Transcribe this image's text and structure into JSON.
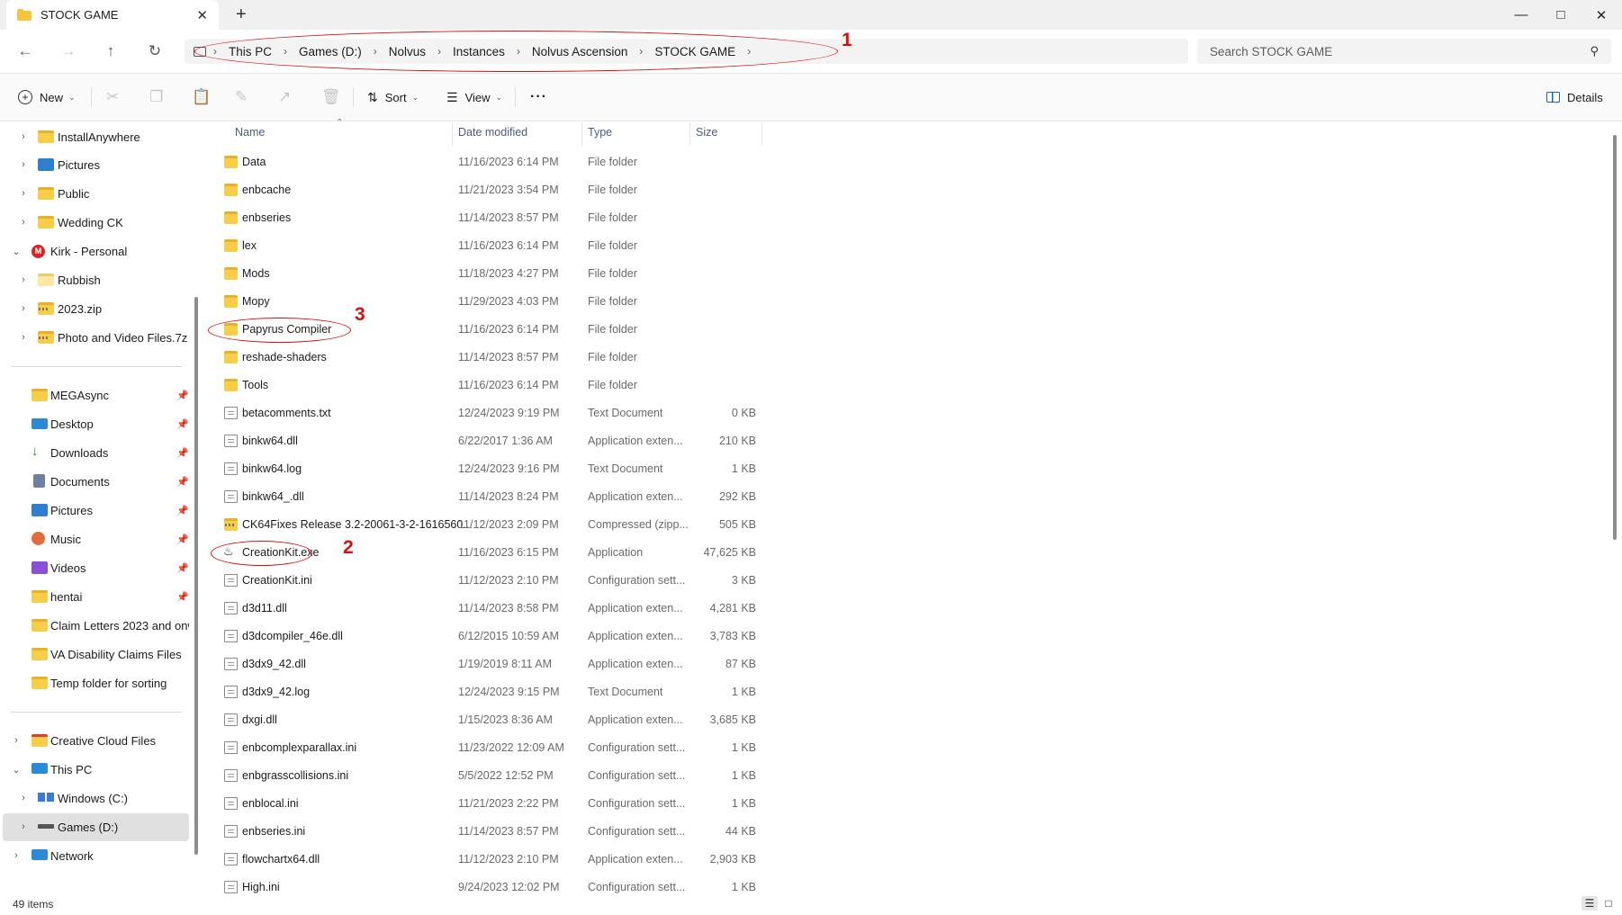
{
  "window": {
    "tab_title": "STOCK GAME",
    "new_tab_glyph": "+",
    "minimize_glyph": "—",
    "maximize_glyph": "□",
    "close_glyph": "✕"
  },
  "address": {
    "breadcrumbs": [
      "This PC",
      "Games (D:)",
      "Nolvus",
      "Instances",
      "Nolvus Ascension",
      "STOCK GAME"
    ],
    "search_placeholder": "Search STOCK GAME"
  },
  "annotations": {
    "one": "1",
    "two": "2",
    "three": "3",
    "color": "#d90f0f"
  },
  "toolbar": {
    "new_label": "New",
    "sort_label": "Sort",
    "view_label": "View",
    "more_glyph": "···",
    "details_label": "Details"
  },
  "sidebar": {
    "items": [
      {
        "label": "InstallAnywhere"
      },
      {
        "label": "Pictures"
      },
      {
        "label": "Public"
      },
      {
        "label": "Wedding CK"
      },
      {
        "label": "Kirk - Personal"
      },
      {
        "label": "Rubbish"
      },
      {
        "label": "2023.zip"
      },
      {
        "label": "Photo and Video Files.7z"
      },
      {
        "label": "MEGAsync"
      },
      {
        "label": "Desktop"
      },
      {
        "label": "Downloads"
      },
      {
        "label": "Documents"
      },
      {
        "label": "Pictures"
      },
      {
        "label": "Music"
      },
      {
        "label": "Videos"
      },
      {
        "label": "hentai"
      },
      {
        "label": "Claim Letters 2023 and onwar"
      },
      {
        "label": "VA Disability Claims Files"
      },
      {
        "label": "Temp folder for sorting"
      },
      {
        "label": "Creative Cloud Files"
      },
      {
        "label": "This PC"
      },
      {
        "label": "Windows (C:)"
      },
      {
        "label": "Games (D:)"
      },
      {
        "label": "Network"
      }
    ]
  },
  "columns": {
    "name": "Name",
    "date": "Date modified",
    "type": "Type",
    "size": "Size"
  },
  "files": [
    {
      "name": "Data",
      "date": "11/16/2023 6:14 PM",
      "type": "File folder",
      "size": ""
    },
    {
      "name": "enbcache",
      "date": "11/21/2023 3:54 PM",
      "type": "File folder",
      "size": ""
    },
    {
      "name": "enbseries",
      "date": "11/14/2023 8:57 PM",
      "type": "File folder",
      "size": ""
    },
    {
      "name": "lex",
      "date": "11/16/2023 6:14 PM",
      "type": "File folder",
      "size": ""
    },
    {
      "name": "Mods",
      "date": "11/18/2023 4:27 PM",
      "type": "File folder",
      "size": ""
    },
    {
      "name": "Mopy",
      "date": "11/29/2023 4:03 PM",
      "type": "File folder",
      "size": ""
    },
    {
      "name": "Papyrus Compiler",
      "date": "11/16/2023 6:14 PM",
      "type": "File folder",
      "size": ""
    },
    {
      "name": "reshade-shaders",
      "date": "11/14/2023 8:57 PM",
      "type": "File folder",
      "size": ""
    },
    {
      "name": "Tools",
      "date": "11/16/2023 6:14 PM",
      "type": "File folder",
      "size": ""
    },
    {
      "name": "betacomments.txt",
      "date": "12/24/2023 9:19 PM",
      "type": "Text Document",
      "size": "0 KB"
    },
    {
      "name": "binkw64.dll",
      "date": "6/22/2017 1:36 AM",
      "type": "Application exten...",
      "size": "210 KB"
    },
    {
      "name": "binkw64.log",
      "date": "12/24/2023 9:16 PM",
      "type": "Text Document",
      "size": "1 KB"
    },
    {
      "name": "binkw64_.dll",
      "date": "11/14/2023 8:24 PM",
      "type": "Application exten...",
      "size": "292 KB"
    },
    {
      "name": "CK64Fixes Release 3.2-20061-3-2-1616560...",
      "date": "11/12/2023 2:09 PM",
      "type": "Compressed (zipp...",
      "size": "505 KB"
    },
    {
      "name": "CreationKit.exe",
      "date": "11/16/2023 6:15 PM",
      "type": "Application",
      "size": "47,625 KB"
    },
    {
      "name": "CreationKit.ini",
      "date": "11/12/2023 2:10 PM",
      "type": "Configuration sett...",
      "size": "3 KB"
    },
    {
      "name": "d3d11.dll",
      "date": "11/14/2023 8:58 PM",
      "type": "Application exten...",
      "size": "4,281 KB"
    },
    {
      "name": "d3dcompiler_46e.dll",
      "date": "6/12/2015 10:59 AM",
      "type": "Application exten...",
      "size": "3,783 KB"
    },
    {
      "name": "d3dx9_42.dll",
      "date": "1/19/2019 8:11 AM",
      "type": "Application exten...",
      "size": "87 KB"
    },
    {
      "name": "d3dx9_42.log",
      "date": "12/24/2023 9:15 PM",
      "type": "Text Document",
      "size": "1 KB"
    },
    {
      "name": "dxgi.dll",
      "date": "1/15/2023 8:36 AM",
      "type": "Application exten...",
      "size": "3,685 KB"
    },
    {
      "name": "enbcomplexparallax.ini",
      "date": "11/23/2022 12:09 AM",
      "type": "Configuration sett...",
      "size": "1 KB"
    },
    {
      "name": "enbgrasscollisions.ini",
      "date": "5/5/2022 12:52 PM",
      "type": "Configuration sett...",
      "size": "1 KB"
    },
    {
      "name": "enblocal.ini",
      "date": "11/21/2023 2:22 PM",
      "type": "Configuration sett...",
      "size": "1 KB"
    },
    {
      "name": "enbseries.ini",
      "date": "11/14/2023 8:57 PM",
      "type": "Configuration sett...",
      "size": "44 KB"
    },
    {
      "name": "flowchartx64.dll",
      "date": "11/12/2023 2:10 PM",
      "type": "Application exten...",
      "size": "2,903 KB"
    },
    {
      "name": "High.ini",
      "date": "9/24/2023 12:02 PM",
      "type": "Configuration sett...",
      "size": "1 KB"
    }
  ],
  "status": {
    "item_count": "49 items"
  }
}
